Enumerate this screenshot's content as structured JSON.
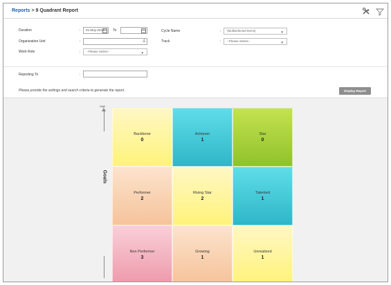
{
  "breadcrumb": {
    "root": "Reports",
    "separator": ">",
    "current": "9 Quadrant Report"
  },
  "form": {
    "duration": {
      "label": "Duration",
      "from_value": "01-May-2018",
      "to_label": "To",
      "to_value": ""
    },
    "organization_unit": {
      "label": "Organization Unit",
      "value": ""
    },
    "work_role": {
      "label": "Work Role",
      "value": "--Please Select--"
    },
    "cycle_name": {
      "label": "Cycle Name",
      "value": "(Multiselected Items)"
    },
    "track": {
      "label": "Track",
      "value": "--Please Select--"
    },
    "reporting_to": {
      "label": "Reporting To",
      "value": ""
    },
    "colon": ":",
    "note": "Please provide the settings and search criteria to generate the report.",
    "display_button": "Display Report"
  },
  "chart": {
    "y_high": "High",
    "y_axis_label": "Goals"
  },
  "quadrants": [
    {
      "name": "Backbone",
      "count": "0",
      "color": "yellow"
    },
    {
      "name": "Achiever",
      "count": "1",
      "color": "teal"
    },
    {
      "name": "Star",
      "count": "0",
      "color": "green"
    },
    {
      "name": "Performer",
      "count": "2",
      "color": "peach"
    },
    {
      "name": "Rising Star",
      "count": "2",
      "color": "yellow"
    },
    {
      "name": "Talented",
      "count": "1",
      "color": "teal"
    },
    {
      "name": "Non Performer",
      "count": "3",
      "color": "pink"
    },
    {
      "name": "Growing",
      "count": "1",
      "color": "peach"
    },
    {
      "name": "Unrealized",
      "count": "1",
      "color": "yellow"
    }
  ],
  "colors": {
    "link": "#1f5fa8",
    "button": "#8e8e8e",
    "chart_bg": "#f1f1f1"
  },
  "icons": {
    "tools": "tools-icon",
    "filter": "filter-icon",
    "calendar": "calendar-icon",
    "user_lookup": "user-lookup-icon"
  }
}
